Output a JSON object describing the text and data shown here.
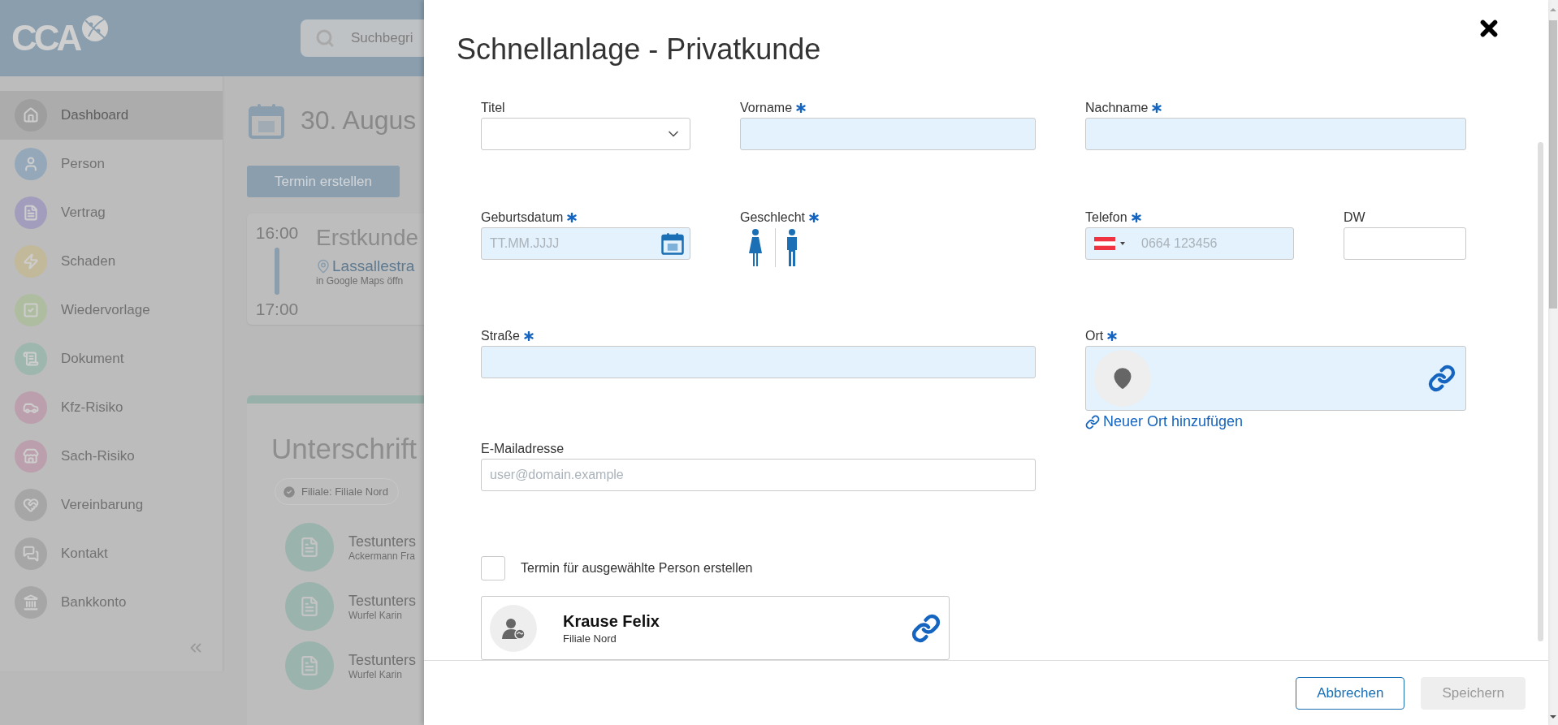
{
  "app": {
    "logo": "CCA",
    "search": {
      "placeholder": "Suchbegri"
    },
    "sidebar": {
      "items": [
        {
          "label": "Dashboard",
          "selected": true,
          "color": "#9e9e9e"
        },
        {
          "label": "Person",
          "selected": false,
          "color": "#94a8ba"
        },
        {
          "label": "Vertrag",
          "selected": false,
          "color": "#a39dbd"
        },
        {
          "label": "Schaden",
          "selected": false,
          "color": "#c2b99a"
        },
        {
          "label": "Wiedervorlage",
          "selected": false,
          "color": "#aebd9f"
        },
        {
          "label": "Dokument",
          "selected": false,
          "color": "#9db6ae"
        },
        {
          "label": "Kfz-Risiko",
          "selected": false,
          "color": "#bc9fac"
        },
        {
          "label": "Sach-Risiko",
          "selected": false,
          "color": "#bc9fac"
        },
        {
          "label": "Vereinbarung",
          "selected": false,
          "color": "#a6a6a6"
        },
        {
          "label": "Kontakt",
          "selected": false,
          "color": "#a6a6a6"
        },
        {
          "label": "Bankkonto",
          "selected": false,
          "color": "#a6a6a6"
        }
      ]
    },
    "date": "30. Augus",
    "create_button": "Termin erstellen",
    "appointment": {
      "start": "16:00",
      "end": "17:00",
      "title": "Erstkunde",
      "location": "Lassallestra",
      "maps_link": "in Google Maps öffn"
    },
    "signatures": {
      "title": "Unterschrift",
      "filter_chip": "Filiale: Filiale Nord",
      "items": [
        {
          "title": "Testunters",
          "subtitle": "Ackermann Fra"
        },
        {
          "title": "Testunters",
          "subtitle": "Wurfel Karin"
        },
        {
          "title": "Testunters",
          "subtitle": "Wurfel Karin"
        }
      ]
    }
  },
  "dialog": {
    "title": "Schnellanlage - Privatkunde",
    "rows": [
      [
        {
          "label": "Titel",
          "kind": "select",
          "required": false
        },
        {
          "label": "Vorname",
          "kind": "text",
          "required": true
        },
        {
          "label": "Nachname",
          "kind": "text",
          "required": true
        }
      ],
      [
        {
          "label": "Geburtsdatum",
          "kind": "date",
          "required": true,
          "placeholder": "TT.MM.JJJJ"
        },
        {
          "label": "Geschlecht",
          "kind": "gender",
          "required": true
        },
        {
          "label": "Telefon",
          "kind": "phone",
          "required": true,
          "placeholder": "0664 123456"
        },
        {
          "label": "DW",
          "kind": "text",
          "required": false
        }
      ],
      [
        {
          "label": "Straße",
          "kind": "text",
          "required": true
        },
        "",
        {
          "label": "Ort",
          "kind": "location",
          "required": true,
          "link": "Neuer Ort hinzufügen"
        }
      ],
      [
        {
          "label": "E-Mailadresse",
          "kind": "text",
          "required": false,
          "placeholder": "user@domain.example"
        }
      ]
    ],
    "checkbox": {
      "label": "Termin für ausgewählte Person erstellen",
      "checked": false
    },
    "person": {
      "name": "Krause Felix",
      "branch": "Filiale Nord"
    },
    "buttons": [
      {
        "label": "Abbrechen",
        "disabled": false
      },
      {
        "label": "Speichern",
        "disabled": true
      }
    ]
  }
}
